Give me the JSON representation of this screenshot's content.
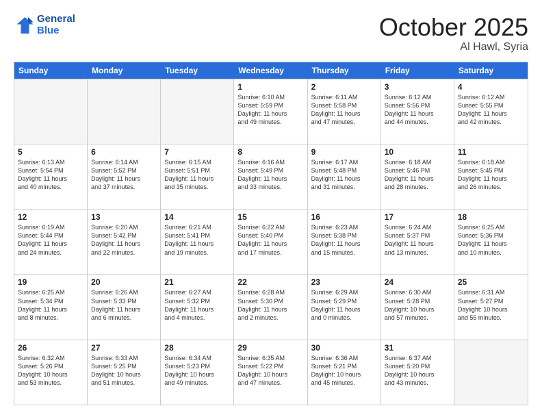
{
  "header": {
    "logo_line1": "General",
    "logo_line2": "Blue",
    "month": "October 2025",
    "location": "Al Hawl, Syria"
  },
  "days_of_week": [
    "Sunday",
    "Monday",
    "Tuesday",
    "Wednesday",
    "Thursday",
    "Friday",
    "Saturday"
  ],
  "weeks": [
    [
      {
        "day": "",
        "empty": true
      },
      {
        "day": "",
        "empty": true
      },
      {
        "day": "",
        "empty": true
      },
      {
        "day": "1",
        "lines": [
          "Sunrise: 6:10 AM",
          "Sunset: 5:59 PM",
          "Daylight: 11 hours",
          "and 49 minutes."
        ]
      },
      {
        "day": "2",
        "lines": [
          "Sunrise: 6:11 AM",
          "Sunset: 5:58 PM",
          "Daylight: 11 hours",
          "and 47 minutes."
        ]
      },
      {
        "day": "3",
        "lines": [
          "Sunrise: 6:12 AM",
          "Sunset: 5:56 PM",
          "Daylight: 11 hours",
          "and 44 minutes."
        ]
      },
      {
        "day": "4",
        "lines": [
          "Sunrise: 6:12 AM",
          "Sunset: 5:55 PM",
          "Daylight: 11 hours",
          "and 42 minutes."
        ]
      }
    ],
    [
      {
        "day": "5",
        "lines": [
          "Sunrise: 6:13 AM",
          "Sunset: 5:54 PM",
          "Daylight: 11 hours",
          "and 40 minutes."
        ]
      },
      {
        "day": "6",
        "lines": [
          "Sunrise: 6:14 AM",
          "Sunset: 5:52 PM",
          "Daylight: 11 hours",
          "and 37 minutes."
        ]
      },
      {
        "day": "7",
        "lines": [
          "Sunrise: 6:15 AM",
          "Sunset: 5:51 PM",
          "Daylight: 11 hours",
          "and 35 minutes."
        ]
      },
      {
        "day": "8",
        "lines": [
          "Sunrise: 6:16 AM",
          "Sunset: 5:49 PM",
          "Daylight: 11 hours",
          "and 33 minutes."
        ]
      },
      {
        "day": "9",
        "lines": [
          "Sunrise: 6:17 AM",
          "Sunset: 5:48 PM",
          "Daylight: 11 hours",
          "and 31 minutes."
        ]
      },
      {
        "day": "10",
        "lines": [
          "Sunrise: 6:18 AM",
          "Sunset: 5:46 PM",
          "Daylight: 11 hours",
          "and 28 minutes."
        ]
      },
      {
        "day": "11",
        "lines": [
          "Sunrise: 6:18 AM",
          "Sunset: 5:45 PM",
          "Daylight: 11 hours",
          "and 26 minutes."
        ]
      }
    ],
    [
      {
        "day": "12",
        "lines": [
          "Sunrise: 6:19 AM",
          "Sunset: 5:44 PM",
          "Daylight: 11 hours",
          "and 24 minutes."
        ]
      },
      {
        "day": "13",
        "lines": [
          "Sunrise: 6:20 AM",
          "Sunset: 5:42 PM",
          "Daylight: 11 hours",
          "and 22 minutes."
        ]
      },
      {
        "day": "14",
        "lines": [
          "Sunrise: 6:21 AM",
          "Sunset: 5:41 PM",
          "Daylight: 11 hours",
          "and 19 minutes."
        ]
      },
      {
        "day": "15",
        "lines": [
          "Sunrise: 6:22 AM",
          "Sunset: 5:40 PM",
          "Daylight: 11 hours",
          "and 17 minutes."
        ]
      },
      {
        "day": "16",
        "lines": [
          "Sunrise: 6:23 AM",
          "Sunset: 5:38 PM",
          "Daylight: 11 hours",
          "and 15 minutes."
        ]
      },
      {
        "day": "17",
        "lines": [
          "Sunrise: 6:24 AM",
          "Sunset: 5:37 PM",
          "Daylight: 11 hours",
          "and 13 minutes."
        ]
      },
      {
        "day": "18",
        "lines": [
          "Sunrise: 6:25 AM",
          "Sunset: 5:36 PM",
          "Daylight: 11 hours",
          "and 10 minutes."
        ]
      }
    ],
    [
      {
        "day": "19",
        "lines": [
          "Sunrise: 6:25 AM",
          "Sunset: 5:34 PM",
          "Daylight: 11 hours",
          "and 8 minutes."
        ]
      },
      {
        "day": "20",
        "lines": [
          "Sunrise: 6:26 AM",
          "Sunset: 5:33 PM",
          "Daylight: 11 hours",
          "and 6 minutes."
        ]
      },
      {
        "day": "21",
        "lines": [
          "Sunrise: 6:27 AM",
          "Sunset: 5:32 PM",
          "Daylight: 11 hours",
          "and 4 minutes."
        ]
      },
      {
        "day": "22",
        "lines": [
          "Sunrise: 6:28 AM",
          "Sunset: 5:30 PM",
          "Daylight: 11 hours",
          "and 2 minutes."
        ]
      },
      {
        "day": "23",
        "lines": [
          "Sunrise: 6:29 AM",
          "Sunset: 5:29 PM",
          "Daylight: 11 hours",
          "and 0 minutes."
        ]
      },
      {
        "day": "24",
        "lines": [
          "Sunrise: 6:30 AM",
          "Sunset: 5:28 PM",
          "Daylight: 10 hours",
          "and 57 minutes."
        ]
      },
      {
        "day": "25",
        "lines": [
          "Sunrise: 6:31 AM",
          "Sunset: 5:27 PM",
          "Daylight: 10 hours",
          "and 55 minutes."
        ]
      }
    ],
    [
      {
        "day": "26",
        "lines": [
          "Sunrise: 6:32 AM",
          "Sunset: 5:26 PM",
          "Daylight: 10 hours",
          "and 53 minutes."
        ]
      },
      {
        "day": "27",
        "lines": [
          "Sunrise: 6:33 AM",
          "Sunset: 5:25 PM",
          "Daylight: 10 hours",
          "and 51 minutes."
        ]
      },
      {
        "day": "28",
        "lines": [
          "Sunrise: 6:34 AM",
          "Sunset: 5:23 PM",
          "Daylight: 10 hours",
          "and 49 minutes."
        ]
      },
      {
        "day": "29",
        "lines": [
          "Sunrise: 6:35 AM",
          "Sunset: 5:22 PM",
          "Daylight: 10 hours",
          "and 47 minutes."
        ]
      },
      {
        "day": "30",
        "lines": [
          "Sunrise: 6:36 AM",
          "Sunset: 5:21 PM",
          "Daylight: 10 hours",
          "and 45 minutes."
        ]
      },
      {
        "day": "31",
        "lines": [
          "Sunrise: 6:37 AM",
          "Sunset: 5:20 PM",
          "Daylight: 10 hours",
          "and 43 minutes."
        ]
      },
      {
        "day": "",
        "empty": true
      }
    ]
  ]
}
